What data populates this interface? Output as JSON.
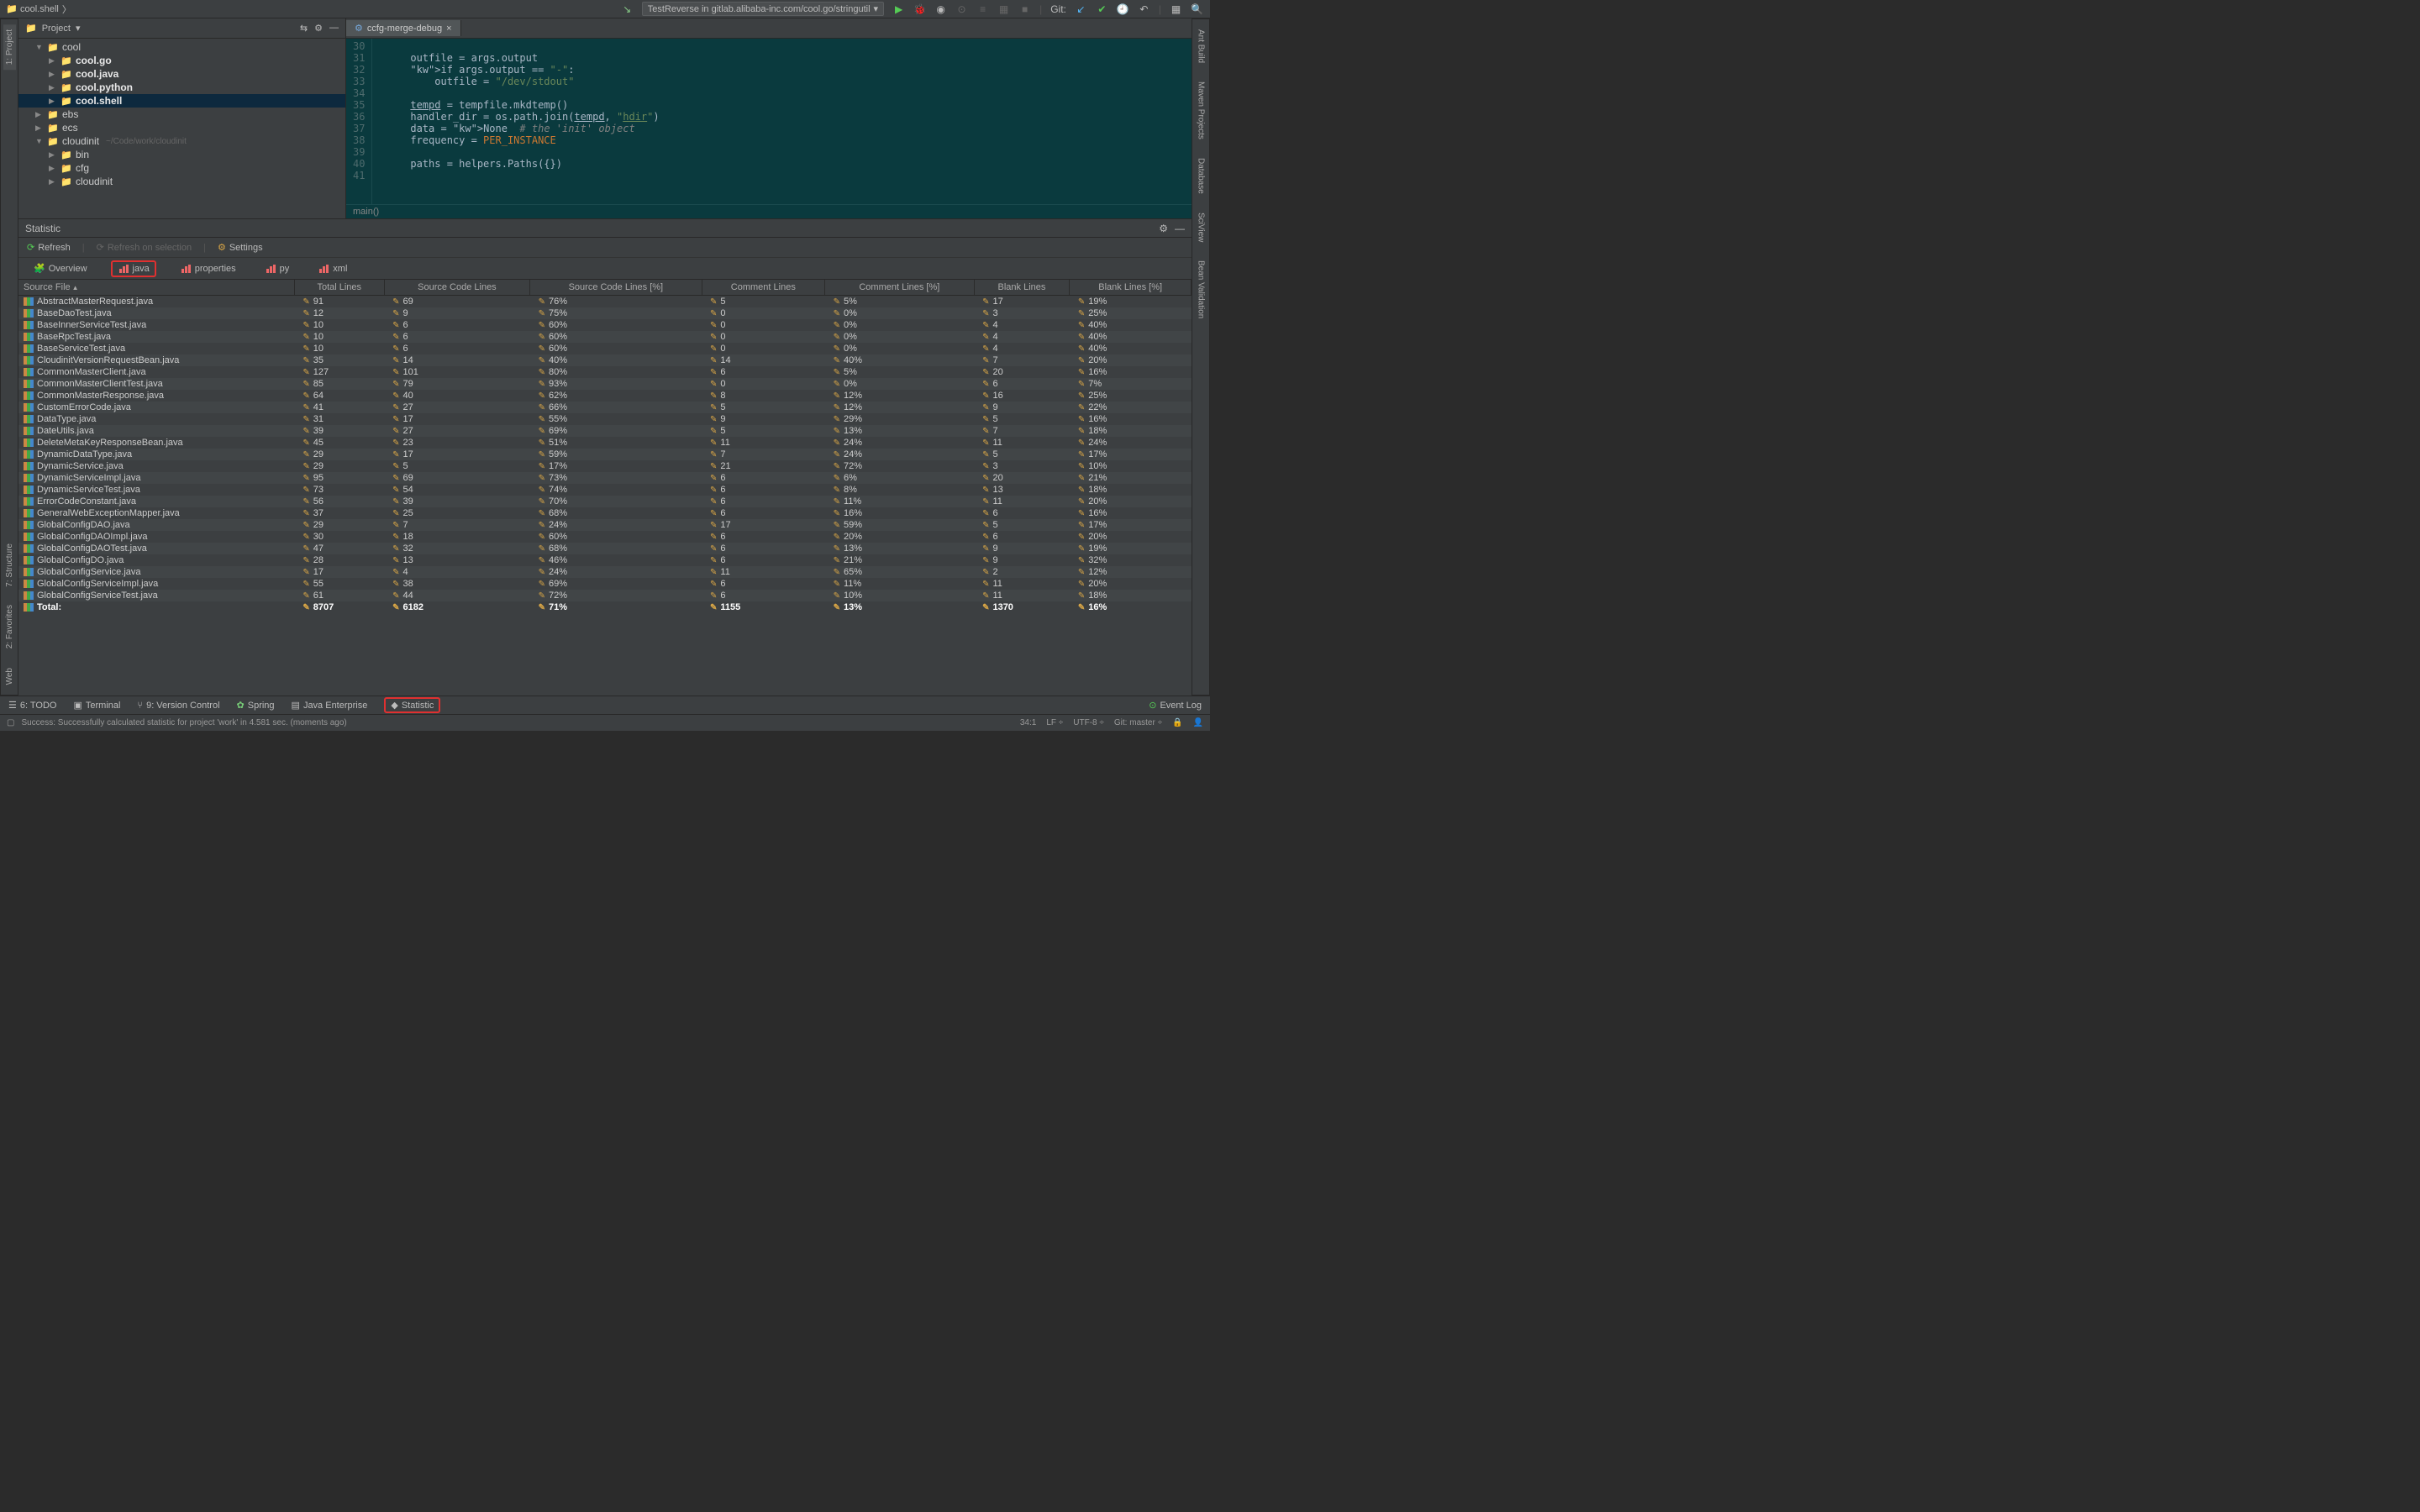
{
  "breadcrumb": {
    "item1": "cool.shell"
  },
  "runconfig": {
    "label": "TestReverse in gitlab.alibaba-inc.com/cool.go/stringutil"
  },
  "git_label": "Git:",
  "project": {
    "header": "Project",
    "items": [
      {
        "indent": 0,
        "arrow": "▼",
        "icon": "📁",
        "label": "cool",
        "bold": false
      },
      {
        "indent": 1,
        "arrow": "▶",
        "icon": "📁",
        "label": "cool.go",
        "bold": true
      },
      {
        "indent": 1,
        "arrow": "▶",
        "icon": "📁",
        "label": "cool.java",
        "bold": true
      },
      {
        "indent": 1,
        "arrow": "▶",
        "icon": "📁",
        "label": "cool.python",
        "bold": true
      },
      {
        "indent": 1,
        "arrow": "▶",
        "icon": "📁",
        "label": "cool.shell",
        "bold": true,
        "selected": true
      },
      {
        "indent": 0,
        "arrow": "▶",
        "icon": "📁",
        "label": "ebs"
      },
      {
        "indent": 0,
        "arrow": "▶",
        "icon": "📁",
        "label": "ecs"
      },
      {
        "indent": 0,
        "arrow": "▼",
        "icon": "📁",
        "label": "cloudinit",
        "hint": "~/Code/work/cloudinit"
      },
      {
        "indent": 1,
        "arrow": "▶",
        "icon": "📁",
        "label": "bin"
      },
      {
        "indent": 1,
        "arrow": "▶",
        "icon": "📁",
        "label": "cfg"
      },
      {
        "indent": 1,
        "arrow": "▶",
        "icon": "📁",
        "label": "cloudinit"
      }
    ]
  },
  "editor": {
    "tab": "ccfg-merge-debug",
    "lines_start": 30,
    "code": [
      "",
      "    outfile = args.output",
      "    if args.output == \"-\":",
      "        outfile = \"/dev/stdout\"",
      "",
      "    tempd = tempfile.mkdtemp()",
      "    handler_dir = os.path.join(tempd, \"hdir\")",
      "    data = None  # the 'init' object",
      "    frequency = PER_INSTANCE",
      "",
      "    paths = helpers.Paths({})",
      ""
    ],
    "breadcrumb": "main()"
  },
  "stat": {
    "title": "Statistic",
    "toolbar": {
      "refresh": "Refresh",
      "refresh_on_sel": "Refresh on selection",
      "settings": "Settings"
    },
    "tabs": {
      "overview": "Overview",
      "java": "java",
      "properties": "properties",
      "py": "py",
      "xml": "xml"
    },
    "columns": [
      "Source File",
      "Total Lines",
      "Source Code Lines",
      "Source Code Lines [%]",
      "Comment Lines",
      "Comment Lines [%]",
      "Blank Lines",
      "Blank Lines [%]"
    ],
    "rows": [
      {
        "file": "AbstractMasterRequest.java",
        "total": 91,
        "src": 69,
        "src_pct": "76%",
        "com": 5,
        "com_pct": "5%",
        "blank": 17,
        "blank_pct": "19%"
      },
      {
        "file": "BaseDaoTest.java",
        "total": 12,
        "src": 9,
        "src_pct": "75%",
        "com": 0,
        "com_pct": "0%",
        "blank": 3,
        "blank_pct": "25%"
      },
      {
        "file": "BaseInnerServiceTest.java",
        "total": 10,
        "src": 6,
        "src_pct": "60%",
        "com": 0,
        "com_pct": "0%",
        "blank": 4,
        "blank_pct": "40%"
      },
      {
        "file": "BaseRpcTest.java",
        "total": 10,
        "src": 6,
        "src_pct": "60%",
        "com": 0,
        "com_pct": "0%",
        "blank": 4,
        "blank_pct": "40%"
      },
      {
        "file": "BaseServiceTest.java",
        "total": 10,
        "src": 6,
        "src_pct": "60%",
        "com": 0,
        "com_pct": "0%",
        "blank": 4,
        "blank_pct": "40%"
      },
      {
        "file": "CloudinitVersionRequestBean.java",
        "total": 35,
        "src": 14,
        "src_pct": "40%",
        "com": 14,
        "com_pct": "40%",
        "blank": 7,
        "blank_pct": "20%"
      },
      {
        "file": "CommonMasterClient.java",
        "total": 127,
        "src": 101,
        "src_pct": "80%",
        "com": 6,
        "com_pct": "5%",
        "blank": 20,
        "blank_pct": "16%"
      },
      {
        "file": "CommonMasterClientTest.java",
        "total": 85,
        "src": 79,
        "src_pct": "93%",
        "com": 0,
        "com_pct": "0%",
        "blank": 6,
        "blank_pct": "7%"
      },
      {
        "file": "CommonMasterResponse.java",
        "total": 64,
        "src": 40,
        "src_pct": "62%",
        "com": 8,
        "com_pct": "12%",
        "blank": 16,
        "blank_pct": "25%"
      },
      {
        "file": "CustomErrorCode.java",
        "total": 41,
        "src": 27,
        "src_pct": "66%",
        "com": 5,
        "com_pct": "12%",
        "blank": 9,
        "blank_pct": "22%"
      },
      {
        "file": "DataType.java",
        "total": 31,
        "src": 17,
        "src_pct": "55%",
        "com": 9,
        "com_pct": "29%",
        "blank": 5,
        "blank_pct": "16%"
      },
      {
        "file": "DateUtils.java",
        "total": 39,
        "src": 27,
        "src_pct": "69%",
        "com": 5,
        "com_pct": "13%",
        "blank": 7,
        "blank_pct": "18%"
      },
      {
        "file": "DeleteMetaKeyResponseBean.java",
        "total": 45,
        "src": 23,
        "src_pct": "51%",
        "com": 11,
        "com_pct": "24%",
        "blank": 11,
        "blank_pct": "24%"
      },
      {
        "file": "DynamicDataType.java",
        "total": 29,
        "src": 17,
        "src_pct": "59%",
        "com": 7,
        "com_pct": "24%",
        "blank": 5,
        "blank_pct": "17%"
      },
      {
        "file": "DynamicService.java",
        "total": 29,
        "src": 5,
        "src_pct": "17%",
        "com": 21,
        "com_pct": "72%",
        "blank": 3,
        "blank_pct": "10%"
      },
      {
        "file": "DynamicServiceImpl.java",
        "total": 95,
        "src": 69,
        "src_pct": "73%",
        "com": 6,
        "com_pct": "6%",
        "blank": 20,
        "blank_pct": "21%"
      },
      {
        "file": "DynamicServiceTest.java",
        "total": 73,
        "src": 54,
        "src_pct": "74%",
        "com": 6,
        "com_pct": "8%",
        "blank": 13,
        "blank_pct": "18%"
      },
      {
        "file": "ErrorCodeConstant.java",
        "total": 56,
        "src": 39,
        "src_pct": "70%",
        "com": 6,
        "com_pct": "11%",
        "blank": 11,
        "blank_pct": "20%"
      },
      {
        "file": "GeneralWebExceptionMapper.java",
        "total": 37,
        "src": 25,
        "src_pct": "68%",
        "com": 6,
        "com_pct": "16%",
        "blank": 6,
        "blank_pct": "16%"
      },
      {
        "file": "GlobalConfigDAO.java",
        "total": 29,
        "src": 7,
        "src_pct": "24%",
        "com": 17,
        "com_pct": "59%",
        "blank": 5,
        "blank_pct": "17%"
      },
      {
        "file": "GlobalConfigDAOImpl.java",
        "total": 30,
        "src": 18,
        "src_pct": "60%",
        "com": 6,
        "com_pct": "20%",
        "blank": 6,
        "blank_pct": "20%"
      },
      {
        "file": "GlobalConfigDAOTest.java",
        "total": 47,
        "src": 32,
        "src_pct": "68%",
        "com": 6,
        "com_pct": "13%",
        "blank": 9,
        "blank_pct": "19%"
      },
      {
        "file": "GlobalConfigDO.java",
        "total": 28,
        "src": 13,
        "src_pct": "46%",
        "com": 6,
        "com_pct": "21%",
        "blank": 9,
        "blank_pct": "32%"
      },
      {
        "file": "GlobalConfigService.java",
        "total": 17,
        "src": 4,
        "src_pct": "24%",
        "com": 11,
        "com_pct": "65%",
        "blank": 2,
        "blank_pct": "12%"
      },
      {
        "file": "GlobalConfigServiceImpl.java",
        "total": 55,
        "src": 38,
        "src_pct": "69%",
        "com": 6,
        "com_pct": "11%",
        "blank": 11,
        "blank_pct": "20%"
      },
      {
        "file": "GlobalConfigServiceTest.java",
        "total": 61,
        "src": 44,
        "src_pct": "72%",
        "com": 6,
        "com_pct": "10%",
        "blank": 11,
        "blank_pct": "18%"
      }
    ],
    "total": {
      "file": "Total:",
      "total": 8707,
      "src": 6182,
      "src_pct": "71%",
      "com": 1155,
      "com_pct": "13%",
      "blank": 1370,
      "blank_pct": "16%"
    }
  },
  "left_tabs": {
    "project": "1: Project"
  },
  "right_tabs": {
    "ant": "Ant Build",
    "maven": "Maven Projects",
    "db": "Database",
    "sci": "SciView",
    "bean": "Bean Validation"
  },
  "side_tabs": {
    "structure": "7: Structure",
    "favorites": "2: Favorites",
    "web": "Web"
  },
  "bottom": {
    "todo": "6: TODO",
    "terminal": "Terminal",
    "vcs": "9: Version Control",
    "spring": "Spring",
    "javaee": "Java Enterprise",
    "statistic": "Statistic",
    "eventlog": "Event Log"
  },
  "status": {
    "msg": "Success: Successfully calculated statistic for project 'work' in 4.581 sec. (moments ago)",
    "pos": "34:1",
    "lf": "LF",
    "enc": "UTF-8",
    "git": "Git: master"
  }
}
